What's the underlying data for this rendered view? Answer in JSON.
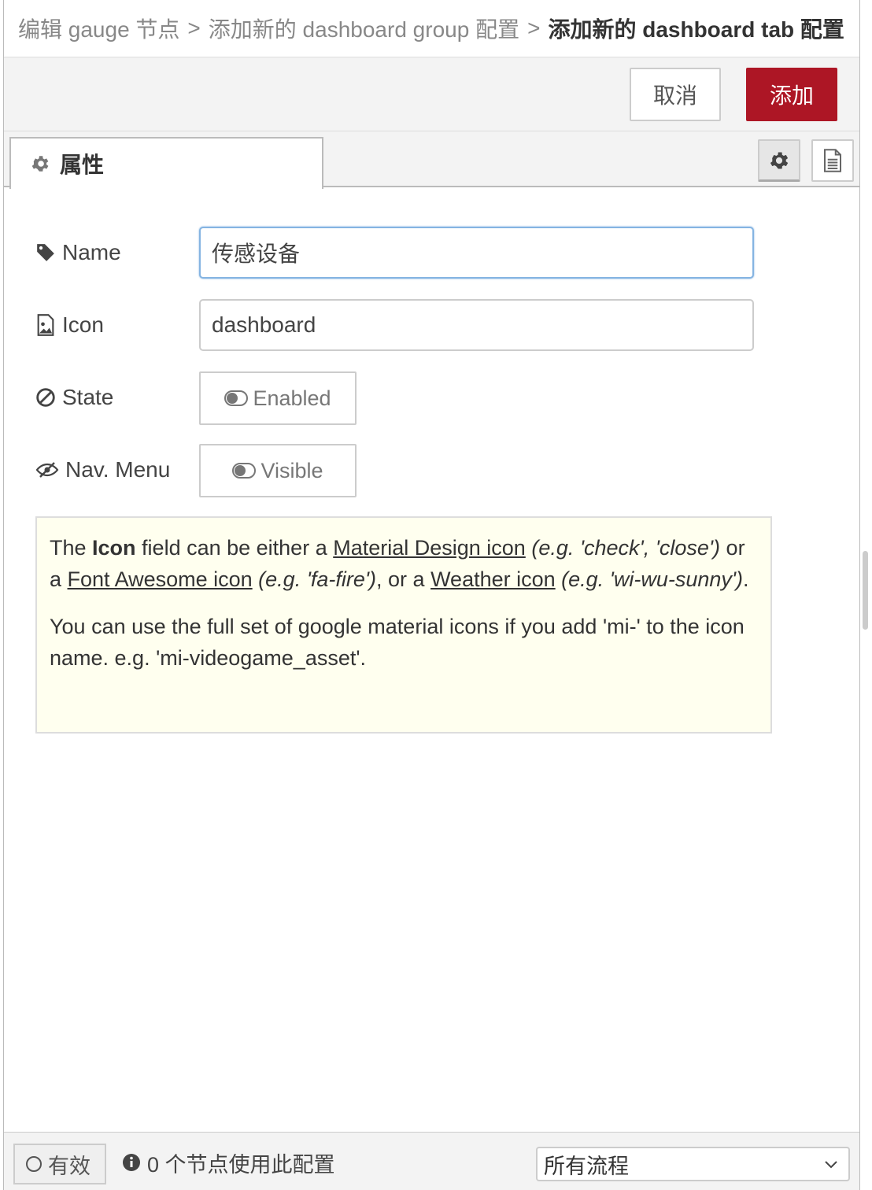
{
  "breadcrumb": {
    "items": [
      "编辑 gauge 节点",
      "添加新的 dashboard group 配置"
    ],
    "separator": ">",
    "current": "添加新的 dashboard tab 配置"
  },
  "toolbar": {
    "cancel_label": "取消",
    "add_label": "添加"
  },
  "tabs": {
    "properties_label": "属性"
  },
  "form": {
    "name": {
      "label": "Name",
      "value": "传感设备"
    },
    "icon": {
      "label": "Icon",
      "value": "dashboard"
    },
    "state": {
      "label": "State",
      "value": "Enabled"
    },
    "nav_menu": {
      "label": "Nav. Menu",
      "value": "Visible"
    }
  },
  "help": {
    "p1_a": "The ",
    "p1_icon": "Icon",
    "p1_b": " field can be either a ",
    "p1_link1": "Material Design icon",
    "p1_ex1": " (e.g. 'check', 'close')",
    "p1_c": " or a ",
    "p1_link2": "Font Awesome icon",
    "p1_ex2": " (e.g. 'fa-fire')",
    "p1_d": ", or a ",
    "p1_link3": "Weather icon",
    "p1_ex3": " (e.g. 'wi-wu-sunny')",
    "p1_e": ".",
    "p2": "You can use the full set of google material icons if you add 'mi-' to the icon name. e.g. 'mi-videogame_asset'."
  },
  "footer": {
    "valid_label": "有效",
    "usage_text": "0 个节点使用此配置",
    "scope_select": "所有流程"
  },
  "colors": {
    "primary": "#ad1625",
    "focus": "#85b4e2",
    "help_bg": "#ffffef"
  },
  "icons": [
    "gear-icon",
    "document-icon",
    "tag-icon",
    "image-icon",
    "ban-icon",
    "eye-slash-icon",
    "toggle-icon",
    "info-icon",
    "chevron-down-icon"
  ]
}
